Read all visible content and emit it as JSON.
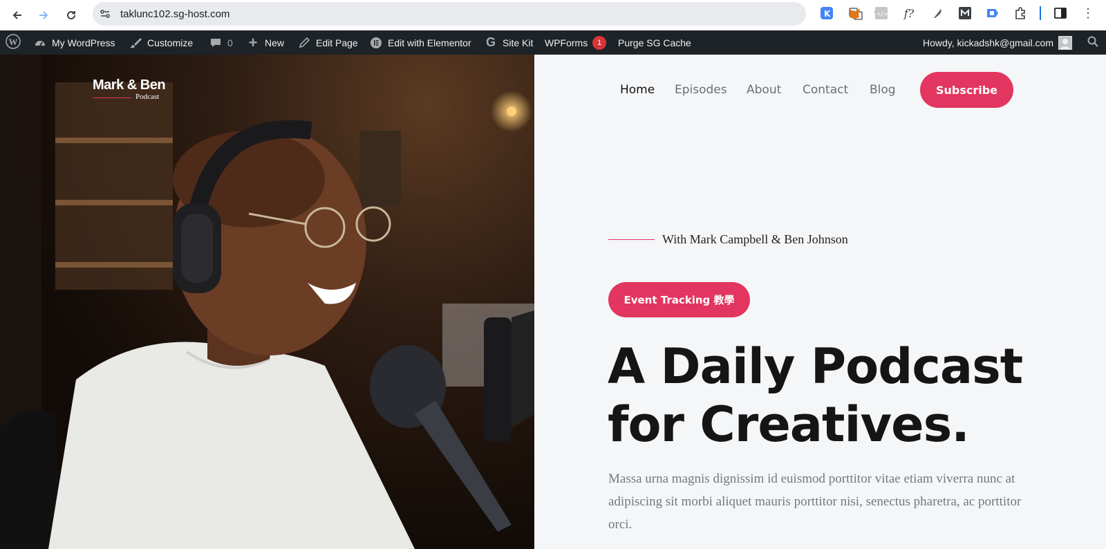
{
  "browser": {
    "url": "taklunc102.sg-host.com"
  },
  "adminbar": {
    "items": [
      {
        "label": "My WordPress"
      },
      {
        "label": "Customize"
      },
      {
        "label": "0"
      },
      {
        "label": "New"
      },
      {
        "label": "Edit Page"
      },
      {
        "label": "Edit with Elementor"
      },
      {
        "label": "Site Kit"
      },
      {
        "label": "WPForms"
      },
      {
        "label": "Purge SG Cache"
      }
    ],
    "wpforms_badge": "1",
    "howdy": "Howdy, kickadshk@gmail.com"
  },
  "logo": {
    "name": "Mark & Ben",
    "sub": "Podcast"
  },
  "nav": {
    "items": [
      {
        "label": "Home"
      },
      {
        "label": "Episodes"
      },
      {
        "label": "About"
      },
      {
        "label": "Contact"
      },
      {
        "label": "Blog"
      }
    ],
    "subscribe": "Subscribe"
  },
  "hero": {
    "tagline": "With Mark Campbell & Ben Johnson",
    "event_button": "Event Tracking 教學",
    "headline_1": "A Daily Podcast",
    "headline_2": "for Creatives.",
    "description": "Massa urna magnis dignissim id euismod porttitor vitae etiam viverra nunc at adipiscing sit morbi aliquet mauris porttitor nisi, senectus pharetra, ac porttitor orci."
  },
  "colors": {
    "accent": "#e2355f",
    "adminbar": "#1d2327"
  }
}
